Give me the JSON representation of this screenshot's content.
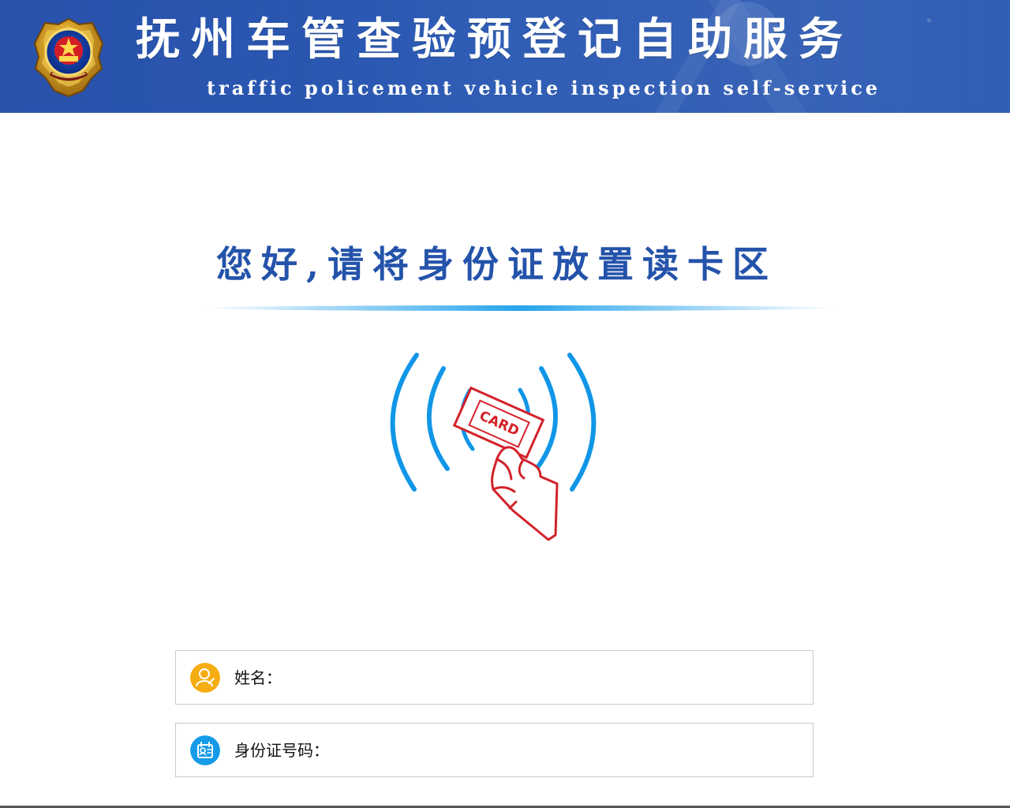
{
  "header": {
    "title": "抚州车管查验预登记自助服务",
    "subtitle": "traffic policement vehicle inspection self-service",
    "logo_icon": "police-badge-icon"
  },
  "main": {
    "prompt": "您好,请将身份证放置读卡区",
    "card_icon": "id-card-reader-icon",
    "card_text": "CARD"
  },
  "fields": {
    "name": {
      "label": "姓名：",
      "value": "",
      "icon": "person-icon"
    },
    "id_number": {
      "label": "身份证号码：",
      "value": "",
      "icon": "id-card-icon"
    }
  },
  "colors": {
    "header_blue": "#2d5bb4",
    "title_blue": "#2453aa",
    "wave_blue": "#1196e7",
    "card_red": "#d3222a",
    "name_icon_orange": "#f6ad12",
    "id_icon_blue": "#159be8"
  }
}
